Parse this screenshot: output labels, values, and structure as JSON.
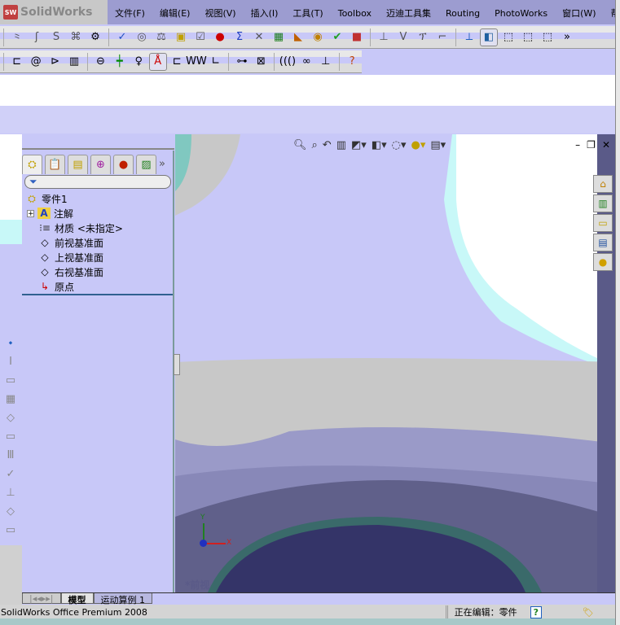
{
  "app": {
    "name": "SolidWorks",
    "logo_text": "SW"
  },
  "menu": [
    "文件(F)",
    "编辑(E)",
    "视图(V)",
    "插入(I)",
    "工具(T)",
    "Toolbox",
    "迈迪工具集",
    "Routing",
    "PhotoWorks",
    "窗口(W)",
    "帮助("
  ],
  "toolbar1": {
    "overflow": "»"
  },
  "feature_manager": {
    "tabs_overflow": "»",
    "tree": [
      {
        "label": "零件1",
        "icon": "part-icon"
      },
      {
        "label": "注解",
        "icon": "annotation-folder-icon",
        "expander": "+"
      },
      {
        "label": "材质 <未指定>",
        "icon": "material-icon"
      },
      {
        "label": "前视基准面",
        "icon": "plane-icon"
      },
      {
        "label": "上视基准面",
        "icon": "plane-icon"
      },
      {
        "label": "右视基准面",
        "icon": "plane-icon"
      },
      {
        "label": "原点",
        "icon": "origin-icon"
      }
    ]
  },
  "viewport": {
    "view_label": "*前视",
    "axis_x": "X",
    "axis_y": "Y"
  },
  "bottom_tabs": [
    "模型",
    "运动算例 1"
  ],
  "status": {
    "product": "SolidWorks Office Premium 2008",
    "editing": "正在编辑：零件",
    "help": "?"
  }
}
